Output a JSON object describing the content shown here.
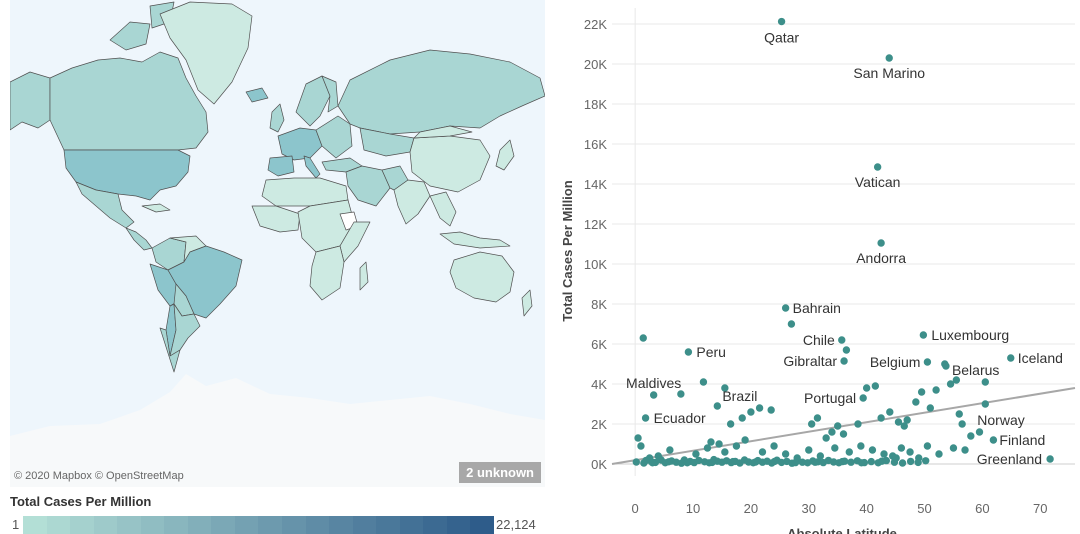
{
  "map": {
    "attribution": "© 2020 Mapbox © OpenStreetMap",
    "unknown_badge": "2 unknown"
  },
  "legend": {
    "title": "Total Cases Per Million",
    "min_label": "1",
    "max_label": "22,124",
    "color_low": "#b3dfd6",
    "color_high": "#2e5c8a"
  },
  "colors": {
    "point": "#3d8f8a",
    "trend": "#a7a7a7",
    "grid": "#e8e8e8",
    "map_water": "#eef6fc",
    "map_land": "#cdeae2",
    "map_land_mid": "#a9d6d3",
    "map_land_high": "#8cc5cc",
    "map_border": "#505050"
  },
  "chart_data": {
    "type": "scatter",
    "xlabel": "Absolute Latitude",
    "ylabel": "Total Cases Per Million",
    "xlim": [
      -4,
      76
    ],
    "ylim": [
      -600,
      22800
    ],
    "x_ticks": [
      0,
      10,
      20,
      30,
      40,
      50,
      60,
      70
    ],
    "x_tick_labels": [
      "0",
      "10",
      "20",
      "30",
      "40",
      "50",
      "60",
      "70"
    ],
    "y_ticks": [
      0,
      2000,
      4000,
      6000,
      8000,
      10000,
      12000,
      14000,
      16000,
      18000,
      20000,
      22000
    ],
    "y_tick_labels": [
      "0K",
      "2K",
      "4K",
      "6K",
      "8K",
      "10K",
      "12K",
      "14K",
      "16K",
      "18K",
      "20K",
      "22K"
    ],
    "grid": "horizontal",
    "trend_line": {
      "x": [
        -4,
        76
      ],
      "y": [
        0,
        3800
      ]
    },
    "labeled_points": [
      {
        "name": "Qatar",
        "x": 25.3,
        "y": 22124
      },
      {
        "name": "San Marino",
        "x": 43.9,
        "y": 20300
      },
      {
        "name": "Vatican",
        "x": 41.9,
        "y": 14850
      },
      {
        "name": "Andorra",
        "x": 42.5,
        "y": 11050
      },
      {
        "name": "Bahrain",
        "x": 26.0,
        "y": 7800
      },
      {
        "name": "Chile",
        "x": 35.7,
        "y": 6200
      },
      {
        "name": "Peru",
        "x": 9.2,
        "y": 5600
      },
      {
        "name": "Luxembourg",
        "x": 49.8,
        "y": 6450
      },
      {
        "name": "Gibraltar",
        "x": 36.1,
        "y": 5150
      },
      {
        "name": "Belgium",
        "x": 50.5,
        "y": 5100
      },
      {
        "name": "Belarus",
        "x": 53.7,
        "y": 4900
      },
      {
        "name": "Iceland",
        "x": 64.9,
        "y": 5300
      },
      {
        "name": "Maldives",
        "x": 3.2,
        "y": 3450
      },
      {
        "name": "Brazil",
        "x": 14.2,
        "y": 2900
      },
      {
        "name": "Portugal",
        "x": 39.4,
        "y": 3300
      },
      {
        "name": "Ecuador",
        "x": 1.8,
        "y": 2300
      },
      {
        "name": "Norway",
        "x": 60.5,
        "y": 3000
      },
      {
        "name": "Finland",
        "x": 61.9,
        "y": 1200
      },
      {
        "name": "Greenland",
        "x": 71.7,
        "y": 250
      }
    ],
    "points": [
      [
        1.4,
        6300
      ],
      [
        7.9,
        3500
      ],
      [
        11.8,
        4100
      ],
      [
        13.1,
        1100
      ],
      [
        15.5,
        3800
      ],
      [
        16.5,
        2000
      ],
      [
        18.5,
        2300
      ],
      [
        20.0,
        2600
      ],
      [
        21.5,
        2800
      ],
      [
        23.5,
        2700
      ],
      [
        27.0,
        7000
      ],
      [
        36.5,
        5700
      ],
      [
        30.5,
        2000
      ],
      [
        31.5,
        2300
      ],
      [
        33.0,
        1300
      ],
      [
        34.0,
        1600
      ],
      [
        35.0,
        1900
      ],
      [
        36.0,
        1500
      ],
      [
        38.5,
        2000
      ],
      [
        40.0,
        3800
      ],
      [
        41.5,
        3900
      ],
      [
        42.5,
        2300
      ],
      [
        44.0,
        2600
      ],
      [
        45.5,
        2100
      ],
      [
        46.5,
        1900
      ],
      [
        47.0,
        2200
      ],
      [
        48.5,
        3100
      ],
      [
        49.5,
        3600
      ],
      [
        51.0,
        2800
      ],
      [
        52.0,
        3700
      ],
      [
        53.5,
        5000
      ],
      [
        54.5,
        4000
      ],
      [
        55.5,
        4200
      ],
      [
        56.0,
        2500
      ],
      [
        56.5,
        2000
      ],
      [
        58.0,
        1400
      ],
      [
        59.5,
        1600
      ],
      [
        60.5,
        4100
      ],
      [
        57.0,
        700
      ],
      [
        55.0,
        800
      ],
      [
        52.5,
        500
      ],
      [
        50.5,
        900
      ],
      [
        0.5,
        1300
      ],
      [
        1.0,
        900
      ],
      [
        2.5,
        300
      ],
      [
        4.0,
        400
      ],
      [
        6.0,
        700
      ],
      [
        8.5,
        200
      ],
      [
        10.5,
        500
      ],
      [
        12.5,
        800
      ],
      [
        14.5,
        1000
      ],
      [
        15.5,
        600
      ],
      [
        17.5,
        900
      ],
      [
        19.0,
        1200
      ],
      [
        22.0,
        600
      ],
      [
        24.0,
        900
      ],
      [
        26.0,
        500
      ],
      [
        28.0,
        300
      ],
      [
        30.0,
        700
      ],
      [
        32.0,
        400
      ],
      [
        34.5,
        800
      ],
      [
        37.0,
        600
      ],
      [
        39.0,
        900
      ],
      [
        41.0,
        700
      ],
      [
        43.0,
        500
      ],
      [
        44.5,
        400
      ],
      [
        46.0,
        800
      ],
      [
        47.5,
        600
      ],
      [
        49.0,
        300
      ],
      [
        0.2,
        100
      ],
      [
        1.5,
        50
      ],
      [
        2.8,
        120
      ],
      [
        3.5,
        80
      ],
      [
        4.5,
        200
      ],
      [
        5.2,
        60
      ],
      [
        6.3,
        150
      ],
      [
        7.1,
        90
      ],
      [
        8.0,
        40
      ],
      [
        9.5,
        130
      ],
      [
        10.2,
        70
      ],
      [
        11.0,
        180
      ],
      [
        12.0,
        110
      ],
      [
        12.8,
        60
      ],
      [
        13.6,
        220
      ],
      [
        14.2,
        140
      ],
      [
        15.0,
        90
      ],
      [
        15.8,
        160
      ],
      [
        16.6,
        70
      ],
      [
        17.3,
        130
      ],
      [
        18.1,
        50
      ],
      [
        18.9,
        200
      ],
      [
        19.6,
        100
      ],
      [
        20.4,
        60
      ],
      [
        21.2,
        170
      ],
      [
        22.0,
        90
      ],
      [
        22.8,
        140
      ],
      [
        23.6,
        50
      ],
      [
        24.5,
        190
      ],
      [
        25.3,
        80
      ],
      [
        26.2,
        130
      ],
      [
        27.1,
        40
      ],
      [
        28.0,
        160
      ],
      [
        28.9,
        90
      ],
      [
        29.8,
        60
      ],
      [
        30.7,
        150
      ],
      [
        31.6,
        110
      ],
      [
        32.5,
        70
      ],
      [
        33.4,
        180
      ],
      [
        34.3,
        100
      ],
      [
        35.2,
        60
      ],
      [
        36.2,
        140
      ],
      [
        37.3,
        90
      ],
      [
        38.4,
        160
      ],
      [
        39.6,
        70
      ],
      [
        40.8,
        120
      ],
      [
        42.0,
        60
      ],
      [
        43.4,
        170
      ],
      [
        44.8,
        90
      ],
      [
        46.2,
        50
      ],
      [
        47.6,
        130
      ],
      [
        48.9,
        80
      ],
      [
        50.2,
        160
      ],
      [
        1.9,
        180
      ],
      [
        3.0,
        60
      ],
      [
        5.8,
        110
      ],
      [
        9.0,
        60
      ],
      [
        13.3,
        80
      ],
      [
        16.9,
        120
      ],
      [
        20.8,
        100
      ],
      [
        24.1,
        130
      ],
      [
        27.7,
        70
      ],
      [
        31.1,
        90
      ],
      [
        35.8,
        120
      ],
      [
        39.1,
        60
      ],
      [
        42.6,
        140
      ],
      [
        45.1,
        300
      ]
    ]
  }
}
